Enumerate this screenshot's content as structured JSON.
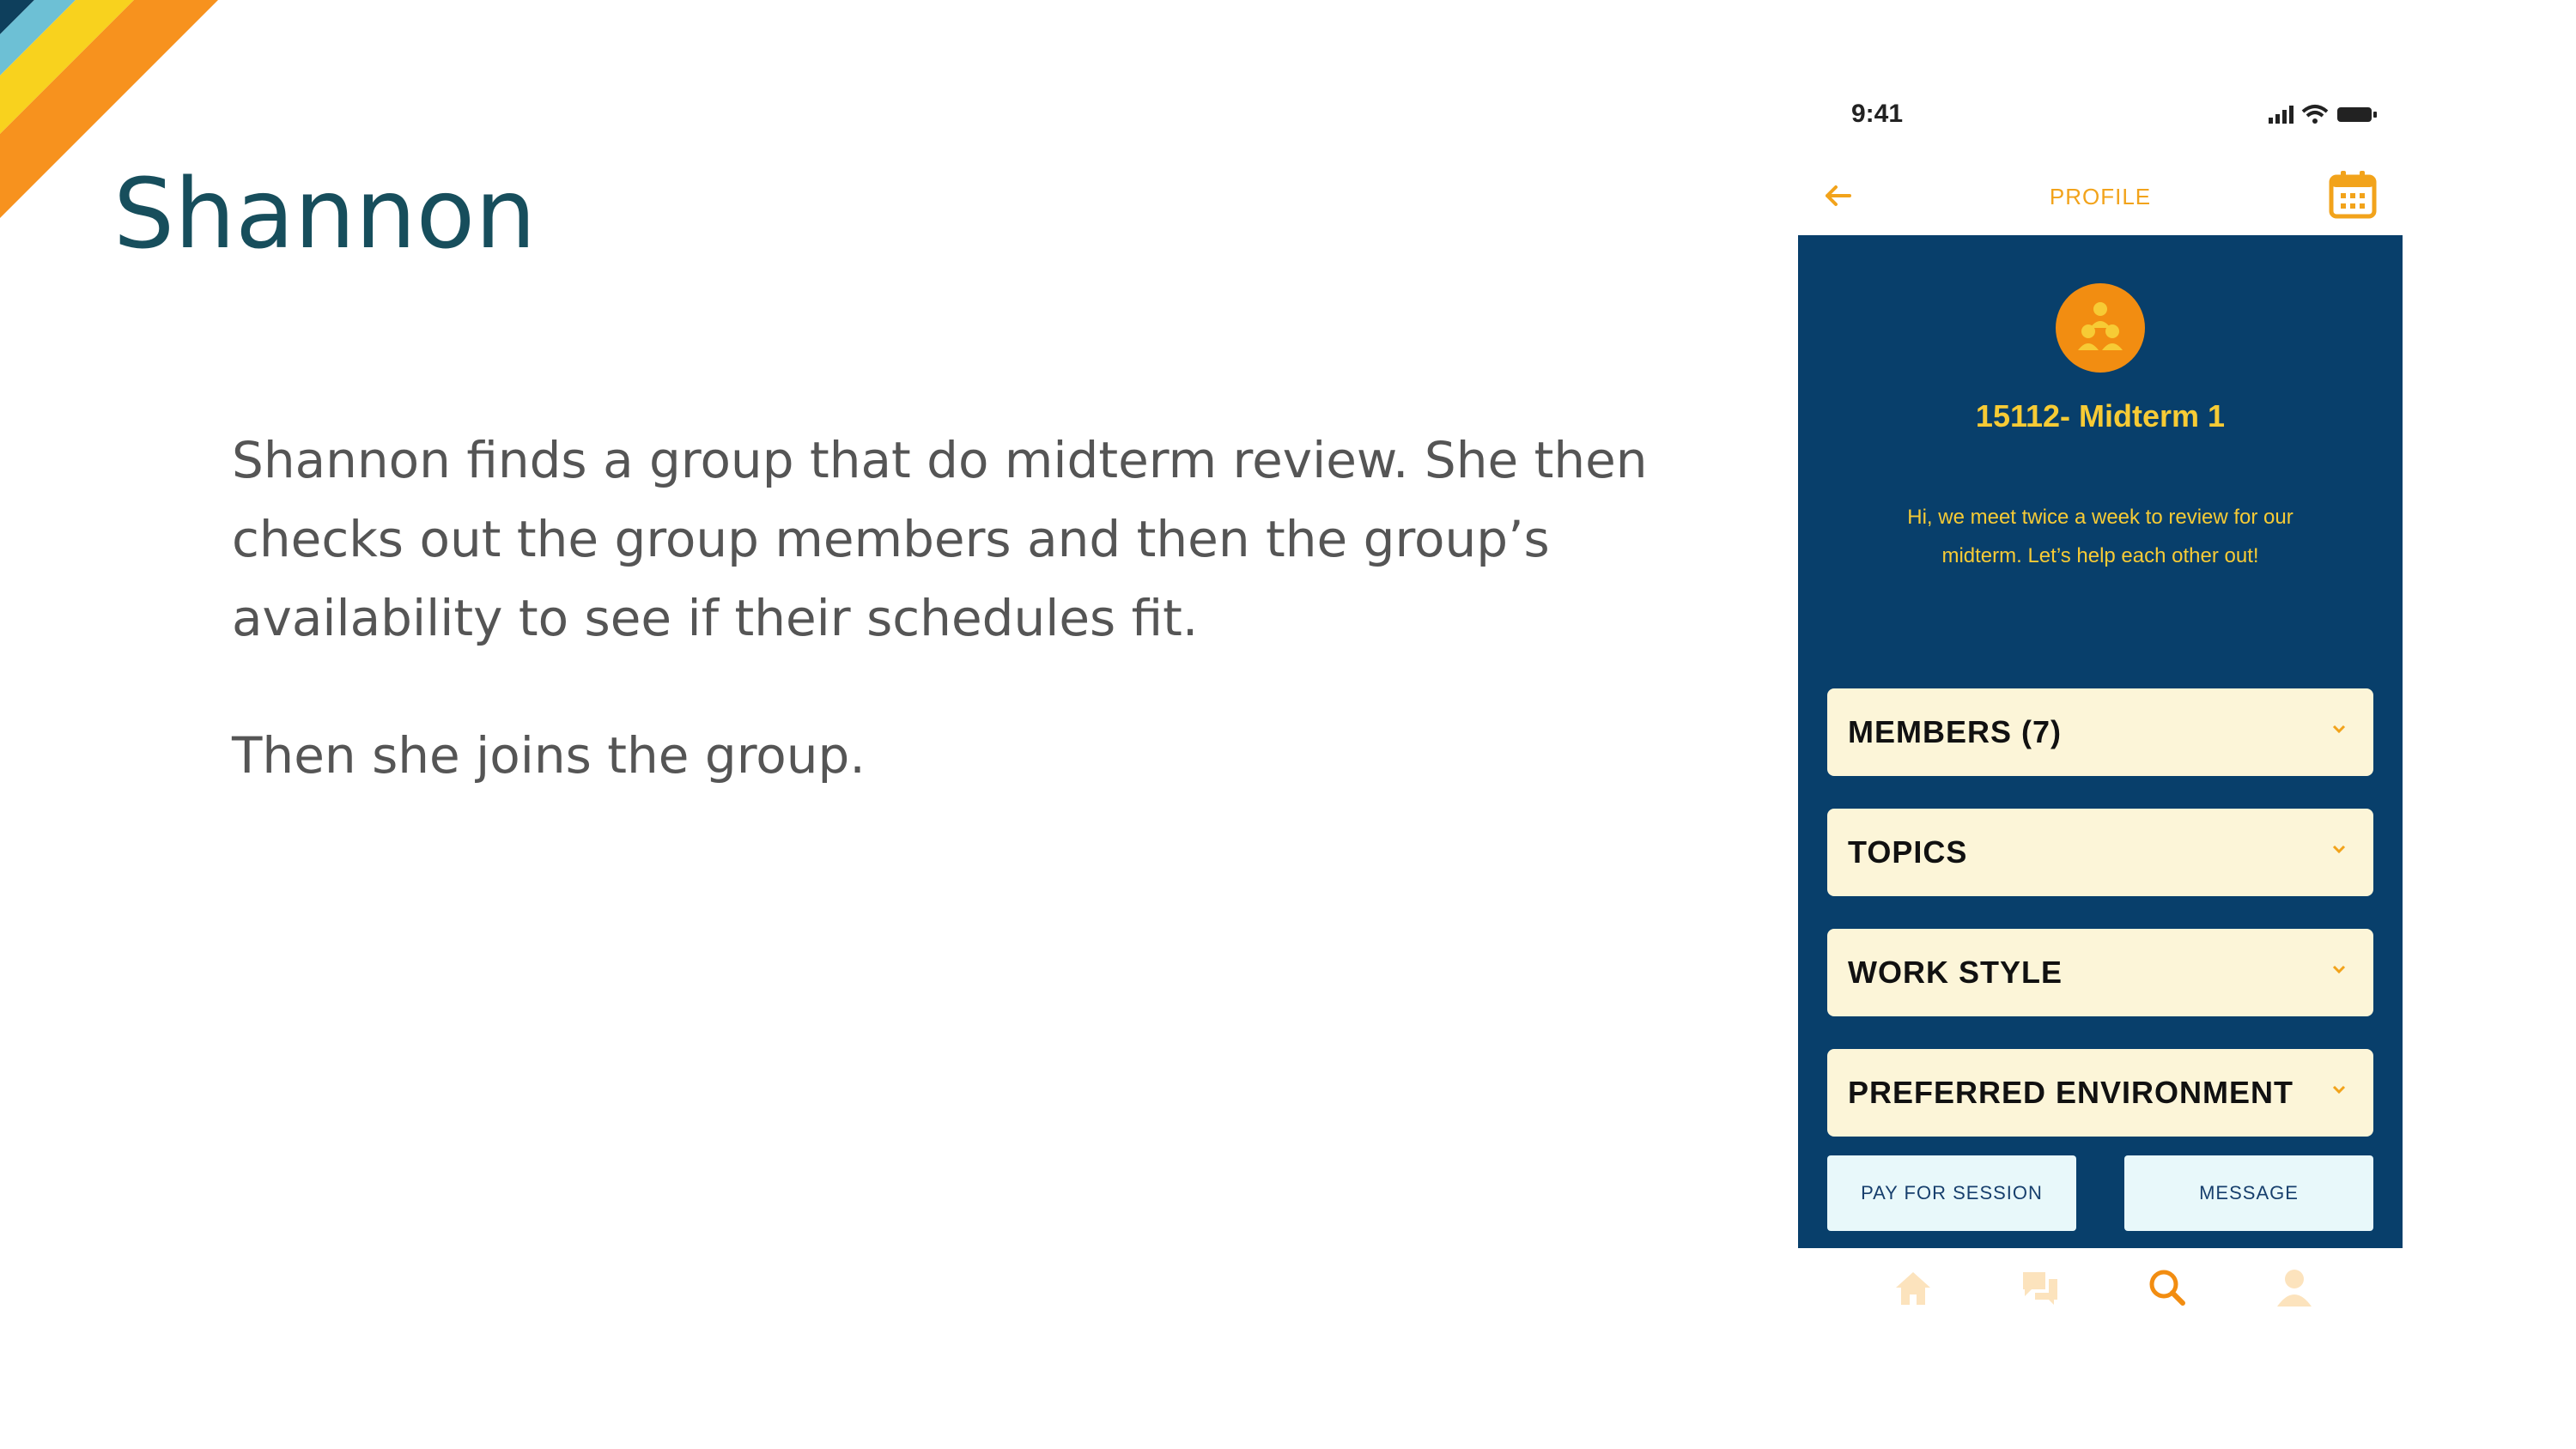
{
  "slide": {
    "title": "Shannon",
    "paragraphs": [
      "Shannon finds a group that do midterm review. She then checks out the group members and then the group’s availability to see if their schedules fit.",
      "Then she joins the group."
    ]
  },
  "phone": {
    "status": {
      "time": "9:41"
    },
    "header": {
      "title": "PROFILE",
      "back_icon": "arrow-left-icon",
      "calendar_icon": "calendar-icon"
    },
    "group": {
      "name": "15112- Midterm 1",
      "description": "Hi, we meet twice a week to review for our midterm. Let’s help each other out!"
    },
    "sections": [
      {
        "label": "MEMBERS (7)"
      },
      {
        "label": "TOPICS"
      },
      {
        "label": "WORK STYLE"
      },
      {
        "label": "PREFERRED ENVIRONMENT"
      }
    ],
    "actions": {
      "pay_label": "PAY FOR SESSION",
      "message_label": "MESSAGE"
    },
    "nav": [
      "home-icon",
      "chat-icon",
      "search-icon",
      "user-icon"
    ]
  },
  "colors": {
    "panel": "#083f6b",
    "accent": "#f2a31b",
    "yellow": "#f7cb35",
    "card": "#fcf5d8",
    "title": "#174e5c"
  }
}
